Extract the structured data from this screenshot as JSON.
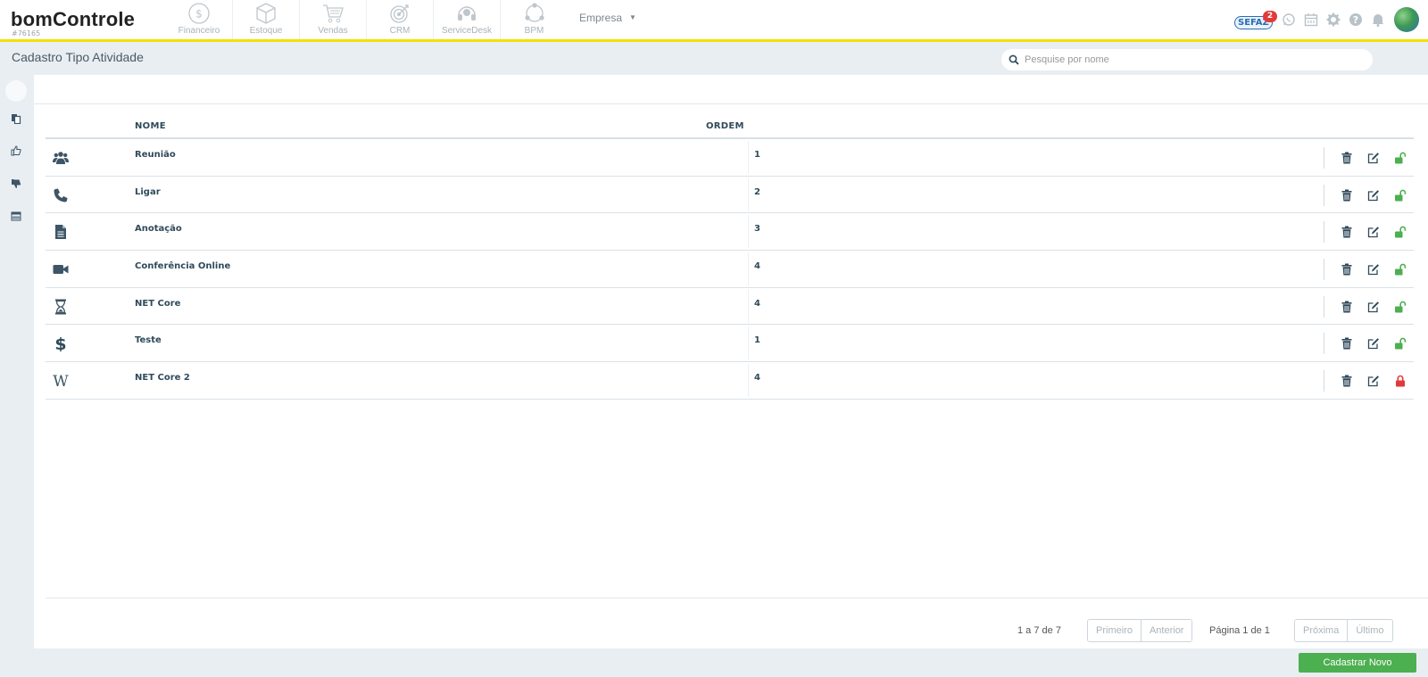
{
  "header": {
    "logo_text": "bomControle",
    "account_id": "#76165",
    "modules": [
      {
        "label": "Financeiro",
        "icon": "dollar-coin-icon"
      },
      {
        "label": "Estoque",
        "icon": "box-icon"
      },
      {
        "label": "Vendas",
        "icon": "cart-icon"
      },
      {
        "label": "CRM",
        "icon": "target-icon"
      },
      {
        "label": "ServiceDesk",
        "icon": "headset-icon"
      },
      {
        "label": "BPM",
        "icon": "process-cycle-icon"
      }
    ],
    "empresa_label": "Empresa",
    "sefaz_label": "SEFAZ",
    "sefaz_badge": "2"
  },
  "page": {
    "title": "Cadastro Tipo Atividade",
    "search_placeholder": "Pesquise por nome"
  },
  "table": {
    "columns": [
      "NOME",
      "ORDEM"
    ],
    "rows": [
      {
        "icon": "users-icon",
        "name": "Reunião",
        "order": "1",
        "status": "unlocked"
      },
      {
        "icon": "phone-icon",
        "name": "Ligar",
        "order": "2",
        "status": "unlocked"
      },
      {
        "icon": "document-icon",
        "name": "Anotação",
        "order": "3",
        "status": "unlocked"
      },
      {
        "icon": "video-camera-icon",
        "name": "Conferência Online",
        "order": "4",
        "status": "unlocked"
      },
      {
        "icon": "hourglass-icon",
        "name": "NET Core",
        "order": "4",
        "status": "unlocked"
      },
      {
        "icon": "dollar-icon",
        "name": "Teste",
        "order": "1",
        "status": "unlocked"
      },
      {
        "icon": "wikipedia-icon",
        "name": "NET Core 2",
        "order": "4",
        "status": "locked"
      }
    ]
  },
  "pagination": {
    "info": "1 a 7 de 7",
    "first": "Primeiro",
    "prev": "Anterior",
    "page_label": "Página 1 de 1",
    "next": "Próxima",
    "last": "Último"
  },
  "actions": {
    "new_label": "Cadastrar Novo"
  },
  "colors": {
    "accent_yellow": "#f1e200",
    "text_dark": "#2f4a5a",
    "unlock_green": "#4caf50",
    "lock_red": "#e23a3a",
    "button_green": "#4caf50"
  }
}
